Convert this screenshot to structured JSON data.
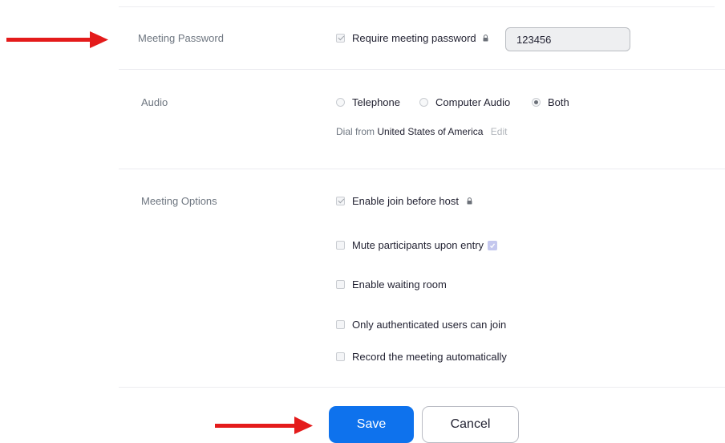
{
  "password_section": {
    "label": "Meeting Password",
    "require_label": "Require meeting password",
    "require_checked": true,
    "password_value": "123456"
  },
  "audio_section": {
    "label": "Audio",
    "options": [
      {
        "label": "Telephone",
        "selected": false
      },
      {
        "label": "Computer Audio",
        "selected": false
      },
      {
        "label": "Both",
        "selected": true
      }
    ],
    "dial_prefix": "Dial from",
    "dial_country": "United States of America",
    "edit_label": "Edit"
  },
  "options_section": {
    "label": "Meeting Options",
    "items": [
      {
        "label": "Enable join before host",
        "checked": true
      },
      {
        "label": "Mute participants upon entry",
        "checked": false
      },
      {
        "label": "Enable waiting room",
        "checked": false
      },
      {
        "label": "Only authenticated users can join",
        "checked": false
      },
      {
        "label": "Record the meeting automatically",
        "checked": false
      }
    ]
  },
  "actions": {
    "save_label": "Save",
    "cancel_label": "Cancel"
  },
  "colors": {
    "save_button": "#0e72ed",
    "arrow": "#e41b1b"
  },
  "icons": {
    "lock": "lock-icon",
    "info": "info-icon",
    "arrow": "red-arrow-annotation-icon"
  }
}
